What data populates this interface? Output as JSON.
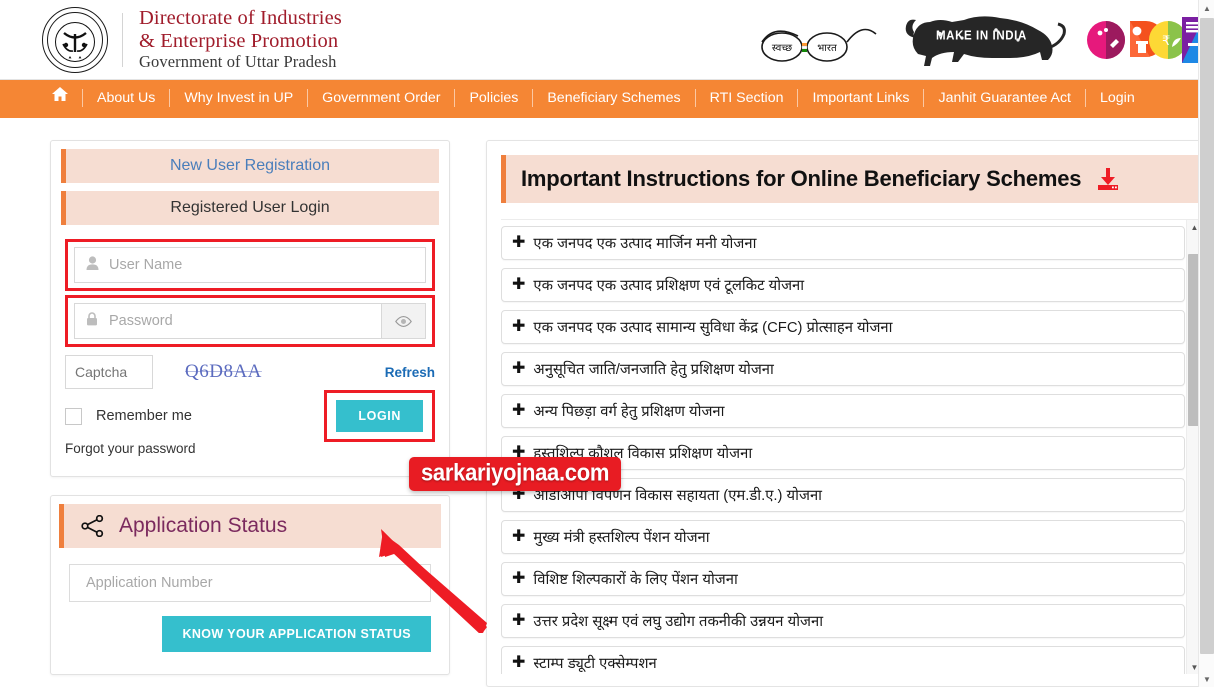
{
  "header": {
    "emblem_icon": "uttar-pradesh-state-emblem",
    "brand_line1": "Directorate of Industries",
    "brand_line2": "& Enterprise Promotion",
    "brand_line3": "Government of Uttar Pradesh",
    "logos": [
      {
        "name": "swachh-bharat-logo",
        "text_left": "स्वच्छ",
        "text_right": "भारत"
      },
      {
        "name": "make-in-india-logo",
        "text": "MAKE IN INDIA"
      },
      {
        "name": "department-colorful-logo",
        "text": ""
      }
    ],
    "accent_orange": "#f58634",
    "brand_red": "#a01c2b"
  },
  "nav": {
    "home_icon": "home-icon",
    "items": [
      "About Us",
      "Why Invest in UP",
      "Government Order",
      "Policies",
      "Beneficiary Schemes",
      "RTI Section",
      "Important Links",
      "Janhit Guarantee Act",
      "Login"
    ]
  },
  "login": {
    "tab_new_user": "New User Registration",
    "tab_registered_user": "Registered User Login",
    "username_placeholder": "User Name",
    "username_value": "",
    "password_placeholder": "Password",
    "password_value": "",
    "captcha_placeholder": "Captcha",
    "captcha_value": "",
    "captcha_code": "Q6D8AA",
    "refresh_label": "Refresh",
    "remember_label": "Remember me",
    "remember_checked": false,
    "login_button": "LOGIN",
    "forgot_label": "Forgot your password",
    "button_color": "#35bfcd",
    "highlight_color": "#ee1c25"
  },
  "application_status": {
    "icon": "share-icon",
    "title": "Application Status",
    "input_placeholder": "Application Number",
    "input_value": "",
    "button_label": "KNOW YOUR APPLICATION STATUS"
  },
  "instructions": {
    "title": "Important Instructions for Online Beneficiary Schemes",
    "download_icon": "download-icon",
    "schemes": [
      "एक जनपद एक उत्पाद मार्जिन मनी योजना",
      "एक जनपद एक उत्पाद प्रशिक्षण एवं टूलकिट योजना",
      "एक जनपद एक उत्पाद सामान्य सुविधा केंद्र (CFC) प्रोत्साहन योजना",
      "अनुसूचित जाति/जनजाति हेतु प्रशिक्षण योजना",
      "अन्य पिछड़ा वर्ग हेतु प्रशिक्षण योजना",
      "हस्तशिल्प कौशल विकास प्रशिक्षण योजना",
      "ओडीओपी विपणन विकास सहायता (एम.डी.ए.) योजना",
      "मुख्य मंत्री हस्तशिल्प पेंशन योजना",
      "विशिष्ट शिल्पकारों के लिए पेंशन योजना",
      "उत्तर प्रदेश सूक्ष्म एवं लघु उद्योग तकनीकी उन्नयन योजना",
      "स्टाम्प ड्यूटी एक्सेम्पशन"
    ]
  },
  "watermark": {
    "text": "sarkariyojnaa.com",
    "color": "#e81c23"
  },
  "annotation": {
    "arrow_color": "#ee1c25",
    "points_to": "LOGIN"
  }
}
